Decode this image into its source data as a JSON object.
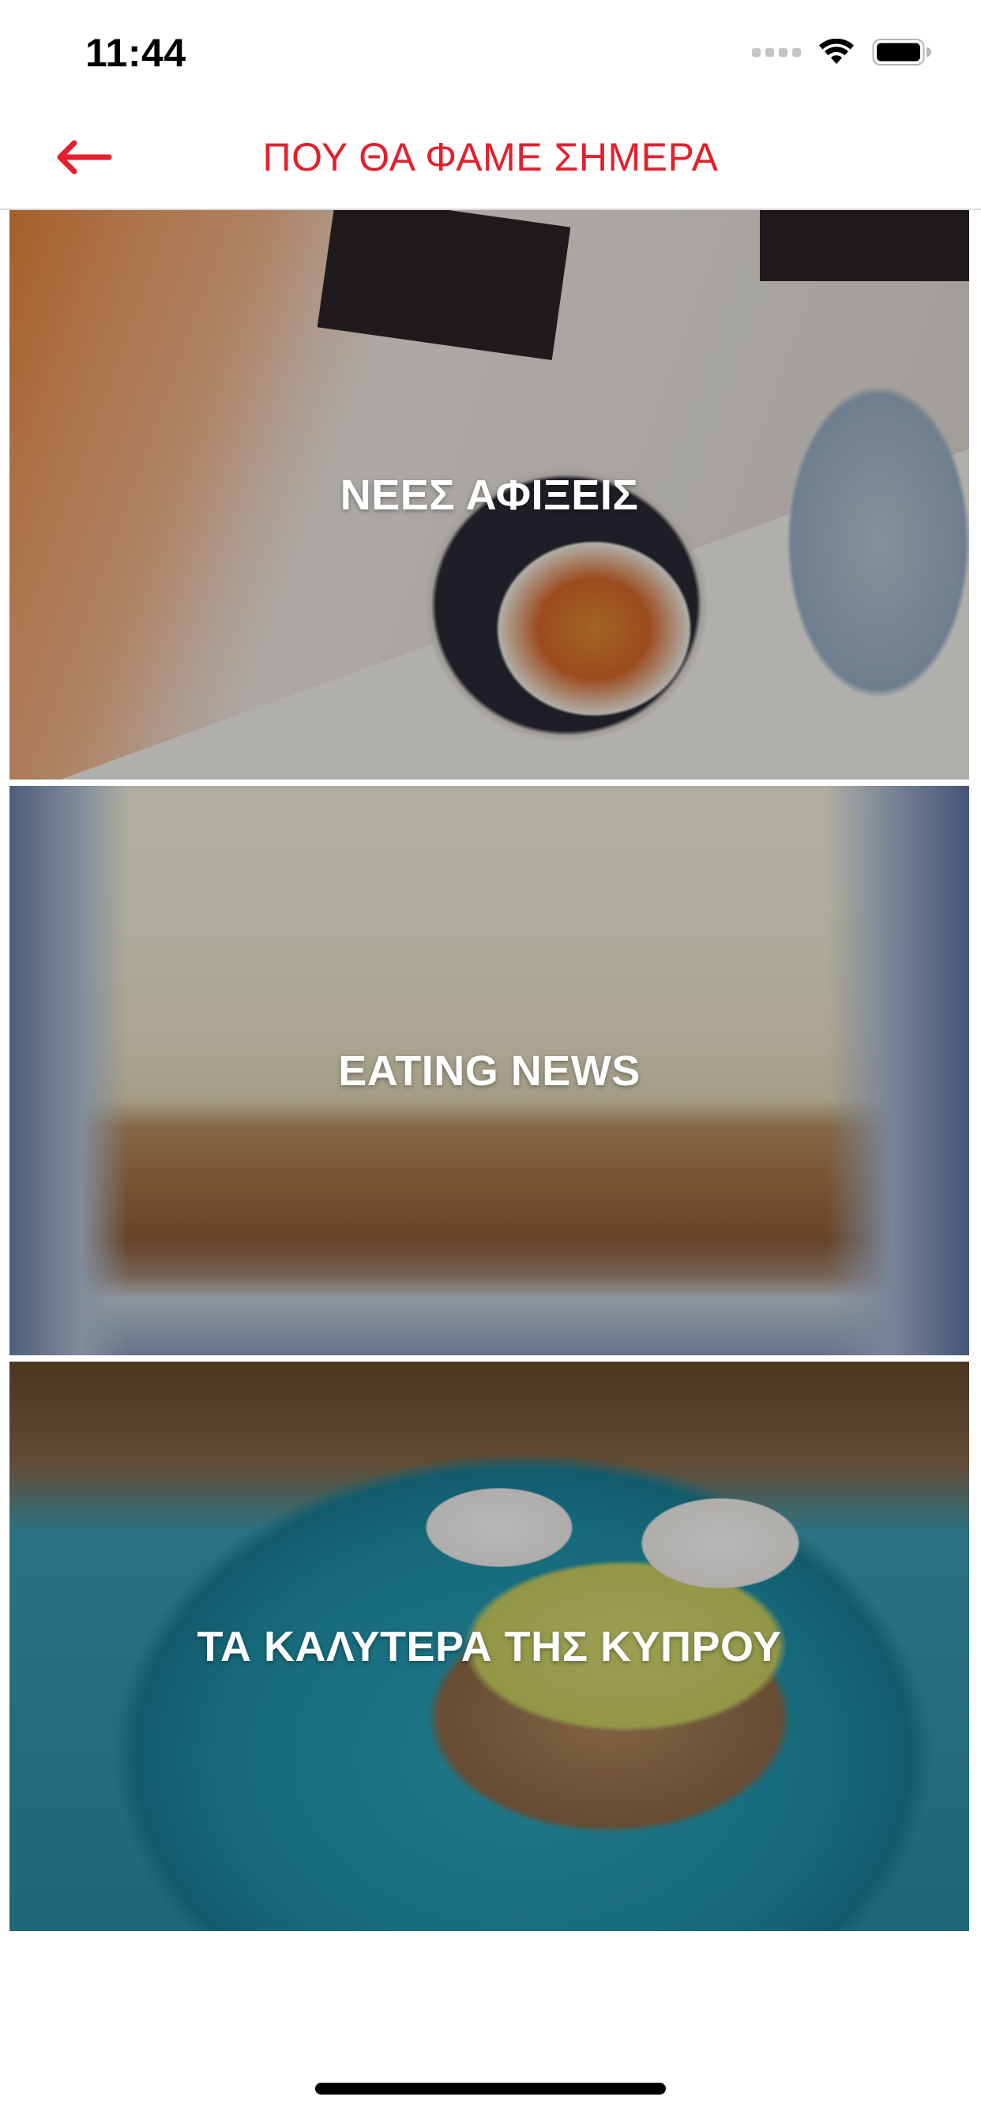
{
  "status_bar": {
    "time": "11:44"
  },
  "nav": {
    "title": "ΠΟΥ ΘΑ ΦΑΜΕ ΣΗΜΕΡΑ",
    "back_icon": "arrow-left-icon",
    "accent_color": "#e3202b"
  },
  "cards": [
    {
      "label": "ΝΕΕΣ ΑΦΙΞΕΙΣ"
    },
    {
      "label": "EATING NEWS"
    },
    {
      "label": "ΤΑ ΚΑΛΥΤΕΡΑ ΤΗΣ ΚΥΠΡΟΥ"
    }
  ]
}
